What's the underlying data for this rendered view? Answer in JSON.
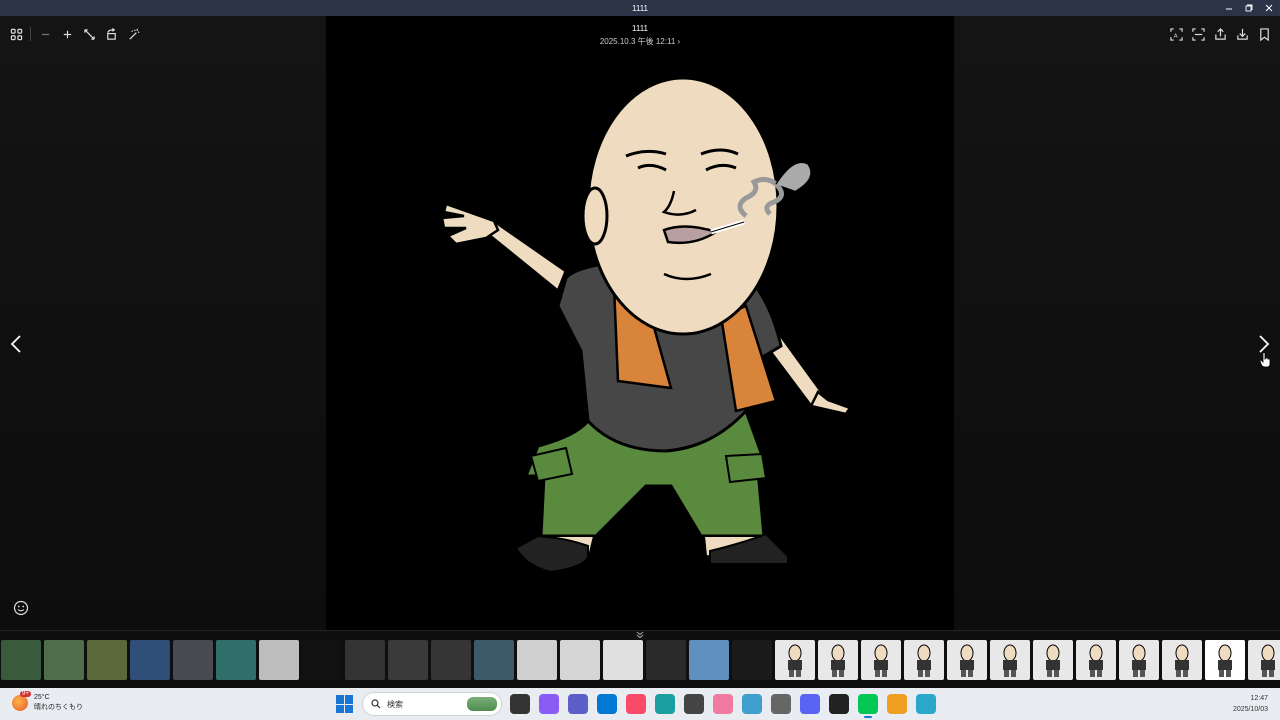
{
  "window": {
    "title": "1111"
  },
  "photo": {
    "name": "1111",
    "date": "2025.10.3 午後 12:11 ›"
  },
  "toolbar": {
    "left_icons": [
      "gallery-grid-icon",
      "zoom-out-icon",
      "zoom-in-icon",
      "fit-to-screen-icon",
      "rotate-icon",
      "magic-edit-icon"
    ],
    "right_icons": [
      "ocr-scan-icon",
      "capture-icon",
      "share-icon",
      "download-icon",
      "bookmark-icon"
    ]
  },
  "filmstrip": {
    "thumbnails": [
      {
        "label": "photo-1",
        "color": "#3a5a3c"
      },
      {
        "label": "photo-2",
        "color": "#4f6e4a"
      },
      {
        "label": "photo-3",
        "color": "#5a6a3a"
      },
      {
        "label": "photo-4",
        "color": "#2f4f78"
      },
      {
        "label": "photo-5",
        "color": "#4a4a52"
      },
      {
        "label": "photo-6",
        "color": "#2f6f6a"
      },
      {
        "label": "photo-7",
        "color": "#bdbdbd"
      },
      {
        "label": "photo-8",
        "color": "#111111"
      },
      {
        "label": "photo-9",
        "color": "#333333"
      },
      {
        "label": "photo-10",
        "color": "#3a3a3a"
      },
      {
        "label": "photo-11",
        "color": "#353535"
      },
      {
        "label": "photo-12",
        "color": "#3d5a6a"
      },
      {
        "label": "photo-13",
        "color": "#cfcfcf"
      },
      {
        "label": "photo-14",
        "color": "#d6d6d6"
      },
      {
        "label": "photo-15",
        "color": "#e0e0e0"
      },
      {
        "label": "photo-16",
        "color": "#2a2a2a"
      },
      {
        "label": "photo-17",
        "color": "#5f8fbf"
      },
      {
        "label": "photo-18",
        "color": "#1a1a1a"
      },
      {
        "label": "photo-19",
        "color": "#e8e8e8"
      },
      {
        "label": "photo-20",
        "color": "#e8e8e8"
      },
      {
        "label": "photo-21",
        "color": "#e8e8e8"
      },
      {
        "label": "photo-22",
        "color": "#e8e8e8"
      },
      {
        "label": "photo-23",
        "color": "#e8e8e8"
      },
      {
        "label": "photo-24",
        "color": "#e8e8e8"
      },
      {
        "label": "photo-25",
        "color": "#e8e8e8"
      },
      {
        "label": "photo-26",
        "color": "#e8e8e8"
      },
      {
        "label": "photo-27",
        "color": "#e8e8e8"
      },
      {
        "label": "photo-28",
        "color": "#e8e8e8"
      },
      {
        "label": "photo-29",
        "color": "#ffffff"
      },
      {
        "label": "photo-30",
        "color": "#e8e8e8"
      },
      {
        "label": "photo-31",
        "color": "#e8e8e8"
      }
    ],
    "selected_index": 28
  },
  "taskbar": {
    "weather_temp": "25°C",
    "weather_desc": "晴れのちくもり",
    "weather_badge": "9+",
    "search_placeholder": "検索",
    "apps": [
      {
        "name": "file-explorer-icon",
        "color": "#333333"
      },
      {
        "name": "copilot-icon",
        "color": "#8a5cf6"
      },
      {
        "name": "teams-icon",
        "color": "#5b5fc7"
      },
      {
        "name": "store-icon",
        "color": "#0078d4"
      },
      {
        "name": "music-icon",
        "color": "#fa4a6a"
      },
      {
        "name": "edge-icon",
        "color": "#1aa0a0"
      },
      {
        "name": "recorder-icon",
        "color": "#444444"
      },
      {
        "name": "cat-app-icon",
        "color": "#f07aa0"
      },
      {
        "name": "feather-app-icon",
        "color": "#3fa0d0"
      },
      {
        "name": "volume-icon",
        "color": "#666666"
      },
      {
        "name": "discord-icon",
        "color": "#5865f2"
      },
      {
        "name": "network-icon",
        "color": "#222222"
      },
      {
        "name": "line-icon",
        "color": "#06c755"
      },
      {
        "name": "coin-icon",
        "color": "#f0a020"
      },
      {
        "name": "notepad-icon",
        "color": "#2aa7c9"
      }
    ],
    "time": "12:47",
    "date": "2025/10/03"
  }
}
